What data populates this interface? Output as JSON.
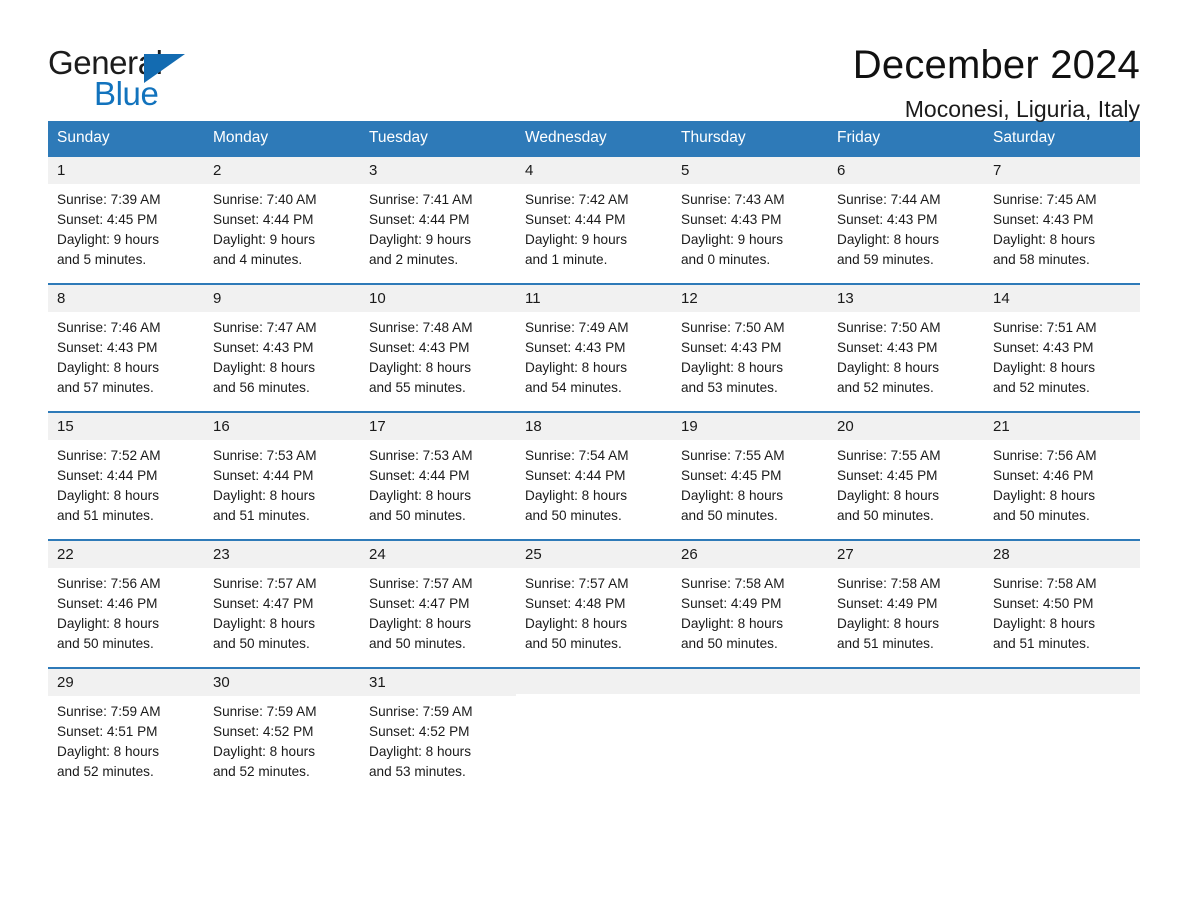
{
  "brand": {
    "word_one": "General",
    "word_two": "Blue",
    "flag_icon": "triangle-flag-icon"
  },
  "header": {
    "title": "December 2024",
    "location": "Moconesi, Liguria, Italy"
  },
  "calendar": {
    "weekday_headers": [
      "Sunday",
      "Monday",
      "Tuesday",
      "Wednesday",
      "Thursday",
      "Friday",
      "Saturday"
    ],
    "accent_color": "#2e7ab8",
    "daynum_band_color": "#f1f1f1",
    "weeks": [
      [
        {
          "day": "1",
          "sunrise": "Sunrise: 7:39 AM",
          "sunset": "Sunset: 4:45 PM",
          "daylight_line1": "Daylight: 9 hours",
          "daylight_line2": "and 5 minutes."
        },
        {
          "day": "2",
          "sunrise": "Sunrise: 7:40 AM",
          "sunset": "Sunset: 4:44 PM",
          "daylight_line1": "Daylight: 9 hours",
          "daylight_line2": "and 4 minutes."
        },
        {
          "day": "3",
          "sunrise": "Sunrise: 7:41 AM",
          "sunset": "Sunset: 4:44 PM",
          "daylight_line1": "Daylight: 9 hours",
          "daylight_line2": "and 2 minutes."
        },
        {
          "day": "4",
          "sunrise": "Sunrise: 7:42 AM",
          "sunset": "Sunset: 4:44 PM",
          "daylight_line1": "Daylight: 9 hours",
          "daylight_line2": "and 1 minute."
        },
        {
          "day": "5",
          "sunrise": "Sunrise: 7:43 AM",
          "sunset": "Sunset: 4:43 PM",
          "daylight_line1": "Daylight: 9 hours",
          "daylight_line2": "and 0 minutes."
        },
        {
          "day": "6",
          "sunrise": "Sunrise: 7:44 AM",
          "sunset": "Sunset: 4:43 PM",
          "daylight_line1": "Daylight: 8 hours",
          "daylight_line2": "and 59 minutes."
        },
        {
          "day": "7",
          "sunrise": "Sunrise: 7:45 AM",
          "sunset": "Sunset: 4:43 PM",
          "daylight_line1": "Daylight: 8 hours",
          "daylight_line2": "and 58 minutes."
        }
      ],
      [
        {
          "day": "8",
          "sunrise": "Sunrise: 7:46 AM",
          "sunset": "Sunset: 4:43 PM",
          "daylight_line1": "Daylight: 8 hours",
          "daylight_line2": "and 57 minutes."
        },
        {
          "day": "9",
          "sunrise": "Sunrise: 7:47 AM",
          "sunset": "Sunset: 4:43 PM",
          "daylight_line1": "Daylight: 8 hours",
          "daylight_line2": "and 56 minutes."
        },
        {
          "day": "10",
          "sunrise": "Sunrise: 7:48 AM",
          "sunset": "Sunset: 4:43 PM",
          "daylight_line1": "Daylight: 8 hours",
          "daylight_line2": "and 55 minutes."
        },
        {
          "day": "11",
          "sunrise": "Sunrise: 7:49 AM",
          "sunset": "Sunset: 4:43 PM",
          "daylight_line1": "Daylight: 8 hours",
          "daylight_line2": "and 54 minutes."
        },
        {
          "day": "12",
          "sunrise": "Sunrise: 7:50 AM",
          "sunset": "Sunset: 4:43 PM",
          "daylight_line1": "Daylight: 8 hours",
          "daylight_line2": "and 53 minutes."
        },
        {
          "day": "13",
          "sunrise": "Sunrise: 7:50 AM",
          "sunset": "Sunset: 4:43 PM",
          "daylight_line1": "Daylight: 8 hours",
          "daylight_line2": "and 52 minutes."
        },
        {
          "day": "14",
          "sunrise": "Sunrise: 7:51 AM",
          "sunset": "Sunset: 4:43 PM",
          "daylight_line1": "Daylight: 8 hours",
          "daylight_line2": "and 52 minutes."
        }
      ],
      [
        {
          "day": "15",
          "sunrise": "Sunrise: 7:52 AM",
          "sunset": "Sunset: 4:44 PM",
          "daylight_line1": "Daylight: 8 hours",
          "daylight_line2": "and 51 minutes."
        },
        {
          "day": "16",
          "sunrise": "Sunrise: 7:53 AM",
          "sunset": "Sunset: 4:44 PM",
          "daylight_line1": "Daylight: 8 hours",
          "daylight_line2": "and 51 minutes."
        },
        {
          "day": "17",
          "sunrise": "Sunrise: 7:53 AM",
          "sunset": "Sunset: 4:44 PM",
          "daylight_line1": "Daylight: 8 hours",
          "daylight_line2": "and 50 minutes."
        },
        {
          "day": "18",
          "sunrise": "Sunrise: 7:54 AM",
          "sunset": "Sunset: 4:44 PM",
          "daylight_line1": "Daylight: 8 hours",
          "daylight_line2": "and 50 minutes."
        },
        {
          "day": "19",
          "sunrise": "Sunrise: 7:55 AM",
          "sunset": "Sunset: 4:45 PM",
          "daylight_line1": "Daylight: 8 hours",
          "daylight_line2": "and 50 minutes."
        },
        {
          "day": "20",
          "sunrise": "Sunrise: 7:55 AM",
          "sunset": "Sunset: 4:45 PM",
          "daylight_line1": "Daylight: 8 hours",
          "daylight_line2": "and 50 minutes."
        },
        {
          "day": "21",
          "sunrise": "Sunrise: 7:56 AM",
          "sunset": "Sunset: 4:46 PM",
          "daylight_line1": "Daylight: 8 hours",
          "daylight_line2": "and 50 minutes."
        }
      ],
      [
        {
          "day": "22",
          "sunrise": "Sunrise: 7:56 AM",
          "sunset": "Sunset: 4:46 PM",
          "daylight_line1": "Daylight: 8 hours",
          "daylight_line2": "and 50 minutes."
        },
        {
          "day": "23",
          "sunrise": "Sunrise: 7:57 AM",
          "sunset": "Sunset: 4:47 PM",
          "daylight_line1": "Daylight: 8 hours",
          "daylight_line2": "and 50 minutes."
        },
        {
          "day": "24",
          "sunrise": "Sunrise: 7:57 AM",
          "sunset": "Sunset: 4:47 PM",
          "daylight_line1": "Daylight: 8 hours",
          "daylight_line2": "and 50 minutes."
        },
        {
          "day": "25",
          "sunrise": "Sunrise: 7:57 AM",
          "sunset": "Sunset: 4:48 PM",
          "daylight_line1": "Daylight: 8 hours",
          "daylight_line2": "and 50 minutes."
        },
        {
          "day": "26",
          "sunrise": "Sunrise: 7:58 AM",
          "sunset": "Sunset: 4:49 PM",
          "daylight_line1": "Daylight: 8 hours",
          "daylight_line2": "and 50 minutes."
        },
        {
          "day": "27",
          "sunrise": "Sunrise: 7:58 AM",
          "sunset": "Sunset: 4:49 PM",
          "daylight_line1": "Daylight: 8 hours",
          "daylight_line2": "and 51 minutes."
        },
        {
          "day": "28",
          "sunrise": "Sunrise: 7:58 AM",
          "sunset": "Sunset: 4:50 PM",
          "daylight_line1": "Daylight: 8 hours",
          "daylight_line2": "and 51 minutes."
        }
      ],
      [
        {
          "day": "29",
          "sunrise": "Sunrise: 7:59 AM",
          "sunset": "Sunset: 4:51 PM",
          "daylight_line1": "Daylight: 8 hours",
          "daylight_line2": "and 52 minutes."
        },
        {
          "day": "30",
          "sunrise": "Sunrise: 7:59 AM",
          "sunset": "Sunset: 4:52 PM",
          "daylight_line1": "Daylight: 8 hours",
          "daylight_line2": "and 52 minutes."
        },
        {
          "day": "31",
          "sunrise": "Sunrise: 7:59 AM",
          "sunset": "Sunset: 4:52 PM",
          "daylight_line1": "Daylight: 8 hours",
          "daylight_line2": "and 53 minutes."
        },
        {
          "day": "",
          "sunrise": "",
          "sunset": "",
          "daylight_line1": "",
          "daylight_line2": ""
        },
        {
          "day": "",
          "sunrise": "",
          "sunset": "",
          "daylight_line1": "",
          "daylight_line2": ""
        },
        {
          "day": "",
          "sunrise": "",
          "sunset": "",
          "daylight_line1": "",
          "daylight_line2": ""
        },
        {
          "day": "",
          "sunrise": "",
          "sunset": "",
          "daylight_line1": "",
          "daylight_line2": ""
        }
      ]
    ]
  }
}
